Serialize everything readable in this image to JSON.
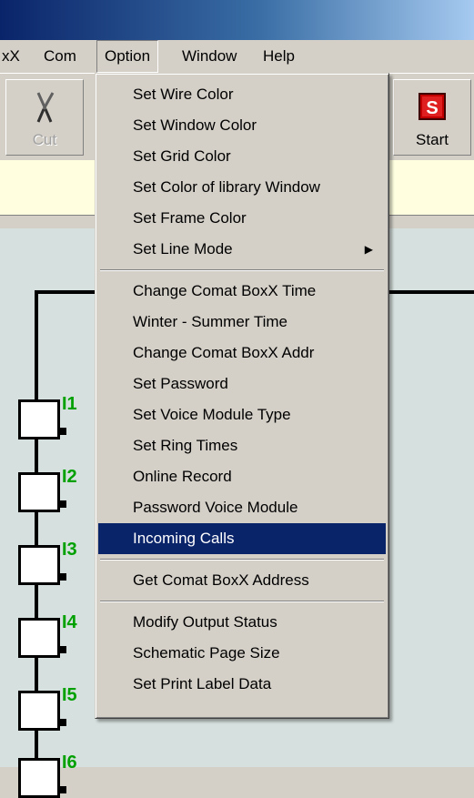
{
  "menubar": {
    "items": [
      {
        "label": "xX"
      },
      {
        "label": "Com"
      },
      {
        "label": "Option"
      },
      {
        "label": "Window"
      },
      {
        "label": "Help"
      }
    ]
  },
  "toolbar": {
    "cut_label": "Cut",
    "start_label": "Start"
  },
  "option_menu": {
    "group1": [
      "Set Wire Color",
      "Set Window Color",
      "Set Grid Color",
      "Set Color of library Window",
      "Set Frame Color",
      "Set  Line Mode"
    ],
    "group2": [
      "Change Comat BoxX Time",
      "Winter - Summer Time",
      "Change Comat BoxX Addr",
      "Set Password",
      "Set Voice Module Type",
      "Set Ring Times",
      "Online Record",
      "Password Voice Module",
      "Incoming Calls"
    ],
    "group3": [
      "Get Comat BoxX Address"
    ],
    "group4": [
      "Modify Output Status",
      "Schematic Page Size",
      "Set Print Label Data"
    ]
  },
  "schematic": {
    "inputs": [
      "I1",
      "I2",
      "I3",
      "I4",
      "I5",
      "I6"
    ]
  },
  "colors": {
    "highlight": "#0a246a",
    "input_label": "#00a000",
    "canvas": "#d6e0de"
  }
}
